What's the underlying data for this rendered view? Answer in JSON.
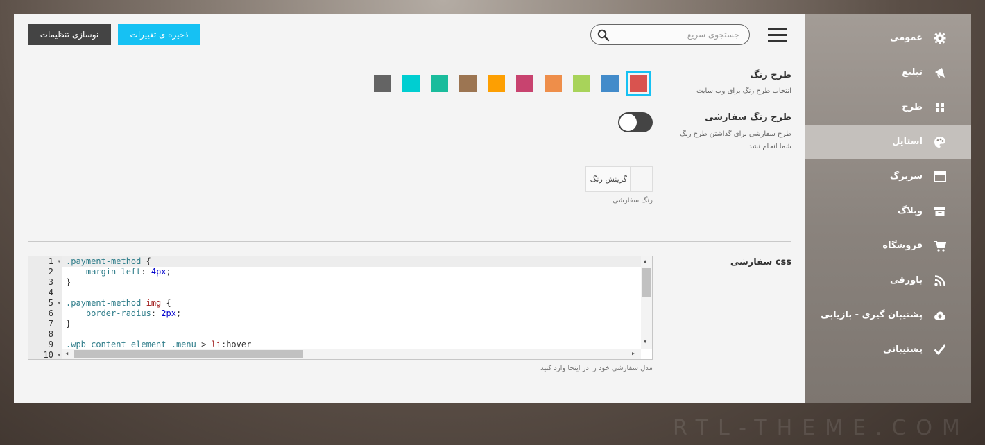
{
  "toolbar": {
    "reset_label": "نوسازی تنظیمات",
    "save_label": "ذخیره ی تغییرات",
    "search_placeholder": "جستجوی سریع"
  },
  "color_scheme": {
    "title": "طرح رنگ",
    "description": "انتخاب طرح رنگ برای وب سایت",
    "selected": "#d9534f",
    "swatches": [
      "#d9534f",
      "#428bca",
      "#a8d35a",
      "#ee8e4a",
      "#c8436f",
      "#fd9f02",
      "#9c7552",
      "#1abc9c",
      "#00ced1",
      "#646464"
    ]
  },
  "custom_scheme": {
    "title": "طرح رنگ سفارشی",
    "description_line1": "طرح سفارشی برای گذاشتن طرح رنگ",
    "description_line2": "شما انجام نشد",
    "toggle_on": false,
    "picker_label": "گزینش رنگ",
    "picker_caption": "رنگ سفارشی"
  },
  "custom_css": {
    "title": "css سفارشی",
    "caption": "مدل سفارشی خود را در اینجا وارد کنید",
    "line_numbers": [
      "1",
      "2",
      "3",
      "4",
      "5",
      "6",
      "7",
      "8",
      "9",
      "10"
    ]
  },
  "sidebar": {
    "items": [
      {
        "label": "عمومی",
        "icon": "gear-icon"
      },
      {
        "label": "تبلیغ",
        "icon": "megaphone-icon"
      },
      {
        "label": "طرح",
        "icon": "grid-icon"
      },
      {
        "label": "استایل",
        "icon": "palette-icon"
      },
      {
        "label": "سربرگ",
        "icon": "browser-window-icon"
      },
      {
        "label": "وبلاگ",
        "icon": "archive-icon"
      },
      {
        "label": "فروشگاه",
        "icon": "cart-icon"
      },
      {
        "label": "باورقی",
        "icon": "rss-icon"
      },
      {
        "label": "پشتیبان گیری - بازیابی",
        "icon": "cloud-upload-icon"
      },
      {
        "label": "پشتیبانی",
        "icon": "check-icon"
      }
    ],
    "active_index": 3
  },
  "watermark": "RTL-THEME.COM"
}
